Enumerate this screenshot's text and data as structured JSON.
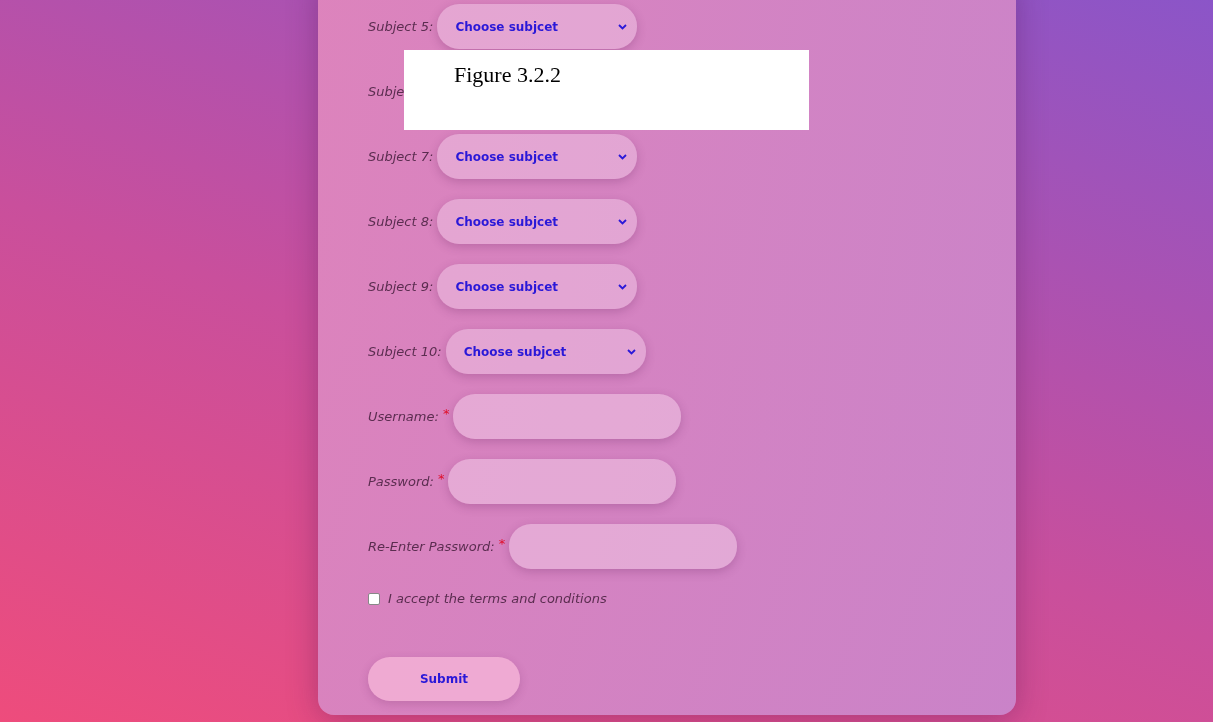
{
  "figure_label": "Figure 3.2.2",
  "subjects": [
    {
      "label": "Subject 5:",
      "select": "Choose subjcet"
    },
    {
      "label": "Subje"
    },
    {
      "label": "Subject 7:",
      "select": "Choose subjcet"
    },
    {
      "label": "Subject 8:",
      "select": "Choose subjcet"
    },
    {
      "label": "Subject 9:",
      "select": "Choose subjcet"
    },
    {
      "label": "Subject 10:",
      "select": "Choose subjcet"
    }
  ],
  "fields": [
    {
      "label": "Username:",
      "required_mark": "*"
    },
    {
      "label": "Password:",
      "required_mark": "*"
    },
    {
      "label": "Re-Enter Password:",
      "required_mark": "*"
    }
  ],
  "terms": {
    "label": "I accept the terms and conditions",
    "checked": false
  },
  "submit": "Submit"
}
